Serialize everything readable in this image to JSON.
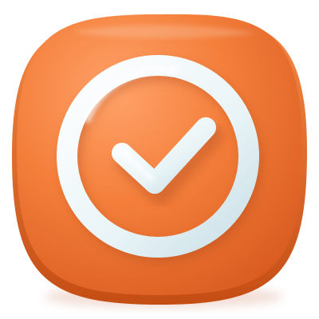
{
  "icon": {
    "name": "check-circle-app-icon",
    "tile_shape": "rounded-square",
    "symbol": "check-mark-in-ring"
  },
  "colors": {
    "background": "#ffffff",
    "tile_light": "#ffa26a",
    "tile_main": "#f47f3b",
    "tile_dark": "#d85a1f",
    "tile_edge": "#c44d14",
    "symbol_light": "#ffffff",
    "symbol_main": "#e9f4f7",
    "symbol_shadow": "#b9d3dc",
    "drop_shadow": "#b8461a"
  }
}
